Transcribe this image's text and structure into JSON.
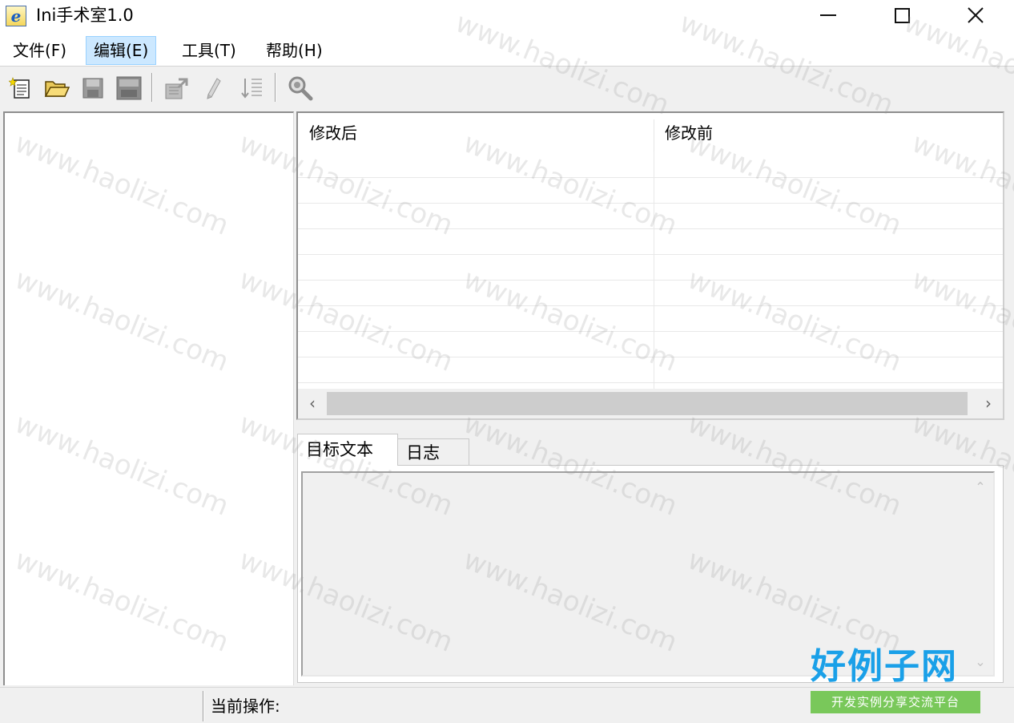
{
  "window": {
    "title": "Ini手术室1.0",
    "icon": "ie-e-icon"
  },
  "menu": {
    "items": [
      {
        "label": "文件(F)"
      },
      {
        "label": "编辑(E)"
      },
      {
        "label": "工具(T)"
      },
      {
        "label": "帮助(H)"
      }
    ]
  },
  "toolbar": {
    "buttons": [
      "new-file-icon",
      "open-folder-icon",
      "save-icon",
      "save-all-icon",
      "export-icon",
      "edit-key-icon",
      "sort-icon",
      "search-icon"
    ]
  },
  "list": {
    "columns": [
      {
        "label": "修改后"
      },
      {
        "label": "修改前"
      }
    ],
    "rows": []
  },
  "tabs": [
    {
      "label": "目标文本",
      "active": true
    },
    {
      "label": "日志",
      "active": false
    }
  ],
  "statusbar": {
    "label": "当前操作:"
  },
  "watermark": {
    "text": "www.haolizi.com"
  },
  "logo": {
    "main": "好例子网",
    "sub": "开发实例分享交流平台"
  },
  "colors": {
    "chrome": "#f0f0f0",
    "menu_hover": "#cce8ff",
    "logo_blue": "#1aa0e8",
    "logo_green": "#79c85a"
  }
}
